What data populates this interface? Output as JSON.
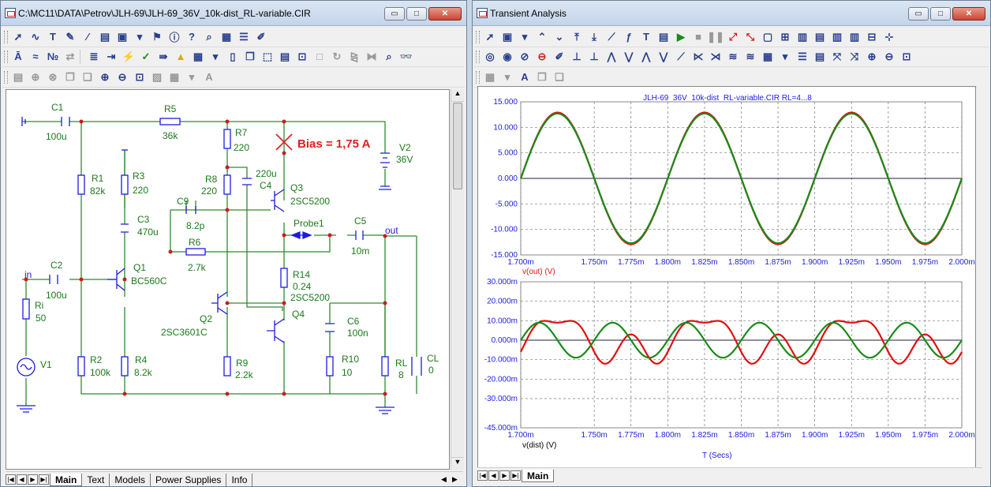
{
  "left_window": {
    "title": "C:\\MC11\\DATA\\Petrov\\JLH-69\\JLH-69_36V_10k-dist_RL-variable.CIR",
    "tabs": [
      "Main",
      "Text",
      "Models",
      "Power Supplies",
      "Info"
    ],
    "active_tab": "Main"
  },
  "right_window": {
    "title": "Transient Analysis",
    "tabs": [
      "Main"
    ],
    "active_tab": "Main"
  },
  "window_buttons": {
    "minimize": "▭",
    "maximize": "□",
    "close": "✕"
  },
  "schematic": {
    "components": {
      "c1": [
        "C1",
        "100u"
      ],
      "r5": [
        "R5",
        "36k"
      ],
      "r7": [
        "R7",
        "220"
      ],
      "v2": [
        "V2",
        "36V"
      ],
      "r1": [
        "R1",
        "82k"
      ],
      "r3": [
        "R3",
        "220"
      ],
      "r8": [
        "R8",
        "220"
      ],
      "c4": [
        "220u",
        "C4"
      ],
      "q3": [
        "Q3",
        "2SC5200"
      ],
      "c9": [
        "C9",
        "8.2p"
      ],
      "c3": [
        "C3",
        "470u"
      ],
      "probe": [
        "Probe1"
      ],
      "c5": [
        "C5",
        "10m"
      ],
      "r6": [
        "R6",
        "2.7k"
      ],
      "c2": [
        "C2",
        "100u"
      ],
      "q1": [
        "Q1",
        "BC560C"
      ],
      "r14": [
        "R14",
        "0.24",
        "2SC5200"
      ],
      "ri": [
        "Ri",
        "50"
      ],
      "q2": [
        "Q2",
        "2SC3601C"
      ],
      "q4": [
        "Q4"
      ],
      "c6": [
        "C6",
        "100n"
      ],
      "v1": [
        "V1"
      ],
      "r2": [
        "R2",
        "100k"
      ],
      "r4": [
        "R4",
        "8.2k"
      ],
      "r9": [
        "R9",
        "2.2k"
      ],
      "r10": [
        "R10",
        "10"
      ],
      "rl": [
        "RL",
        "8"
      ],
      "cl": [
        "CL",
        "0"
      ]
    },
    "node_in": "in",
    "node_out": "out",
    "bias_text": "Bias = 1,75 A",
    "colors": {
      "wire": "#2e8b2e",
      "component": "#1c1ce0",
      "label": "#1a7a1a",
      "bias": "#e02020"
    }
  },
  "chart_data": [
    {
      "type": "line",
      "title": "JLH-69_36V_10k-dist_RL-variable.CIR RL=4...8",
      "x_ticks": [
        "1.700m",
        "1.750m",
        "1.775m",
        "1.800m",
        "1.825m",
        "1.850m",
        "1.875m",
        "1.900m",
        "1.925m",
        "1.950m",
        "1.975m",
        "2.000m"
      ],
      "y_ticks": [
        "15.000",
        "10.000",
        "5.000",
        "0.000",
        "-5.000",
        "-10.000",
        "-15.000"
      ],
      "xlim": [
        1.7,
        2.0
      ],
      "ylim": [
        -15,
        15
      ],
      "ylabel": "v(out) (V)",
      "series": [
        {
          "color": "#e01010",
          "amplitude": 12.9,
          "period_ms": 0.1,
          "zero_cross_ms": 1.7
        },
        {
          "color": "#1a8a1a",
          "amplitude": 12.7,
          "period_ms": 0.1,
          "zero_cross_ms": 1.7
        }
      ]
    },
    {
      "type": "line",
      "x_ticks": [
        "1.700m",
        "1.750m",
        "1.775m",
        "1.800m",
        "1.825m",
        "1.850m",
        "1.875m",
        "1.900m",
        "1.925m",
        "1.950m",
        "1.975m",
        "2.000m"
      ],
      "y_ticks": [
        "30.000m",
        "20.000m",
        "10.000m",
        "0.000m",
        "-10.000m",
        "-20.000m",
        "-30.000m",
        "-45.000m"
      ],
      "xlim": [
        1.7,
        2.0
      ],
      "ylim": [
        -45,
        30
      ],
      "ylabel": "v(dist) (V)",
      "xlabel": "T (Secs)",
      "series": [
        {
          "color": "#e01010",
          "peaks_mV": [
            -21,
            15,
            -21,
            15,
            -21,
            15
          ],
          "shape": "distortion"
        },
        {
          "color": "#1a8a1a",
          "amplitude_mV": 9,
          "period_ms": 0.05
        }
      ]
    }
  ]
}
